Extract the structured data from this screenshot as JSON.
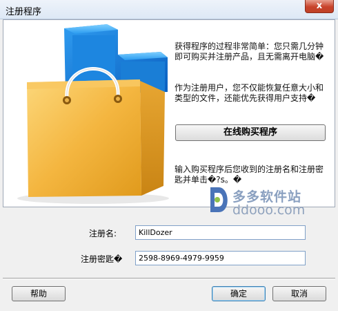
{
  "window": {
    "title": "注册程序",
    "close_label": "x"
  },
  "info": {
    "para1": "获得程序的过程非常简单：您只需几分钟即可购买并注册产品，且无需离开电脑�",
    "para2": "作为注册用户，您不仅能恢复任意大小和类型的文件，还能优先获得用户支持�",
    "buy_button": "在线购买程序",
    "para3": "输入购买程序后您收到的注册名和注册密匙并单击�?s。�"
  },
  "watermark": {
    "line1": "多多软件站",
    "line2": "ddooo.com"
  },
  "form": {
    "name_label": "注册名:",
    "name_value": "KillDozer",
    "key_label": "注册密匙�",
    "key_value": "2598-8969-4979-9959"
  },
  "buttons": {
    "help": "帮助",
    "ok": "确定",
    "cancel": "取消"
  },
  "colors": {
    "bag": "#f2b94a",
    "box": "#1a8fe8",
    "title_bg": "#dde8f5"
  }
}
